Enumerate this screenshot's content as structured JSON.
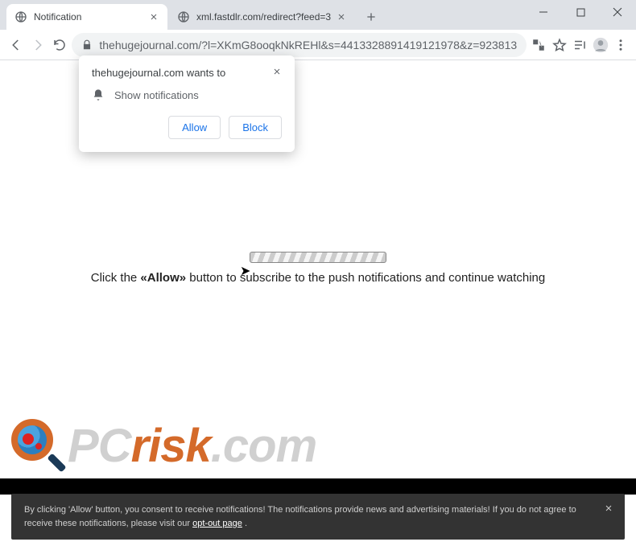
{
  "window": {
    "tabs": [
      {
        "title": "Notification",
        "favicon": "globe"
      },
      {
        "title": "xml.fastdlr.com/redirect?feed=3",
        "favicon": "globe"
      }
    ]
  },
  "nav": {
    "back_icon": "arrow-left",
    "fwd_icon": "arrow-right",
    "reload_icon": "reload"
  },
  "address": {
    "lock_icon": "lock",
    "url": "thehugejournal.com/?l=XKmG8ooqkNkREHl&s=4413328891419121978&z=923813"
  },
  "toolbar": {
    "translate_icon": "translate",
    "star_icon": "star",
    "readlist_icon": "reading-list",
    "avatar_icon": "person",
    "menu_icon": "dots-vertical"
  },
  "permission": {
    "title": "thehugejournal.com wants to",
    "item": "Show notifications",
    "allow": "Allow",
    "block": "Block"
  },
  "page": {
    "instruction_pre": "Click the ",
    "instruction_bold": "«Allow»",
    "instruction_post": " button to subscribe to the push notifications and continue watching"
  },
  "watermark": {
    "p": "P",
    "c": "C",
    "risk": "risk",
    "dotcom": ".com"
  },
  "consent": {
    "text": "By clicking 'Allow' button, you consent to receive notifications! The notifications provide news and advertising materials! If you do not agree to receive these notifications, please visit our ",
    "link": "opt-out page",
    "tail": "."
  }
}
